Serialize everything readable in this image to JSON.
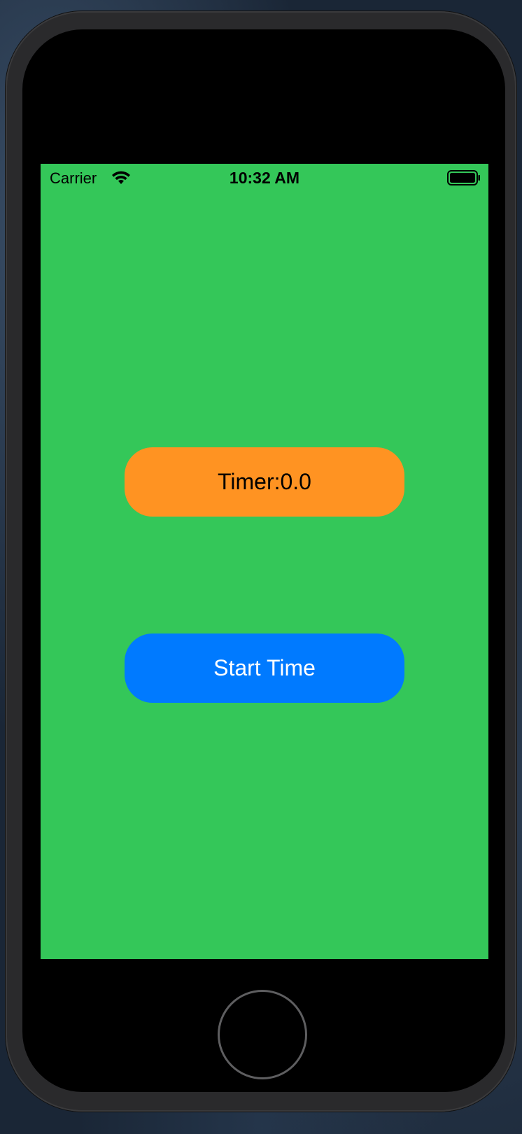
{
  "status_bar": {
    "carrier": "Carrier",
    "time": "10:32 AM",
    "wifi_icon": "wifi-icon",
    "battery_icon": "battery-full-icon"
  },
  "main": {
    "timer_label": "Timer:0.0",
    "start_button_label": "Start Time"
  },
  "device": {
    "home_button_icon": "home-button"
  },
  "colors": {
    "screen_background": "#34c759",
    "timer_background": "#ff9322",
    "button_background": "#007aff",
    "button_text": "#ffffff",
    "label_text": "#000000"
  }
}
